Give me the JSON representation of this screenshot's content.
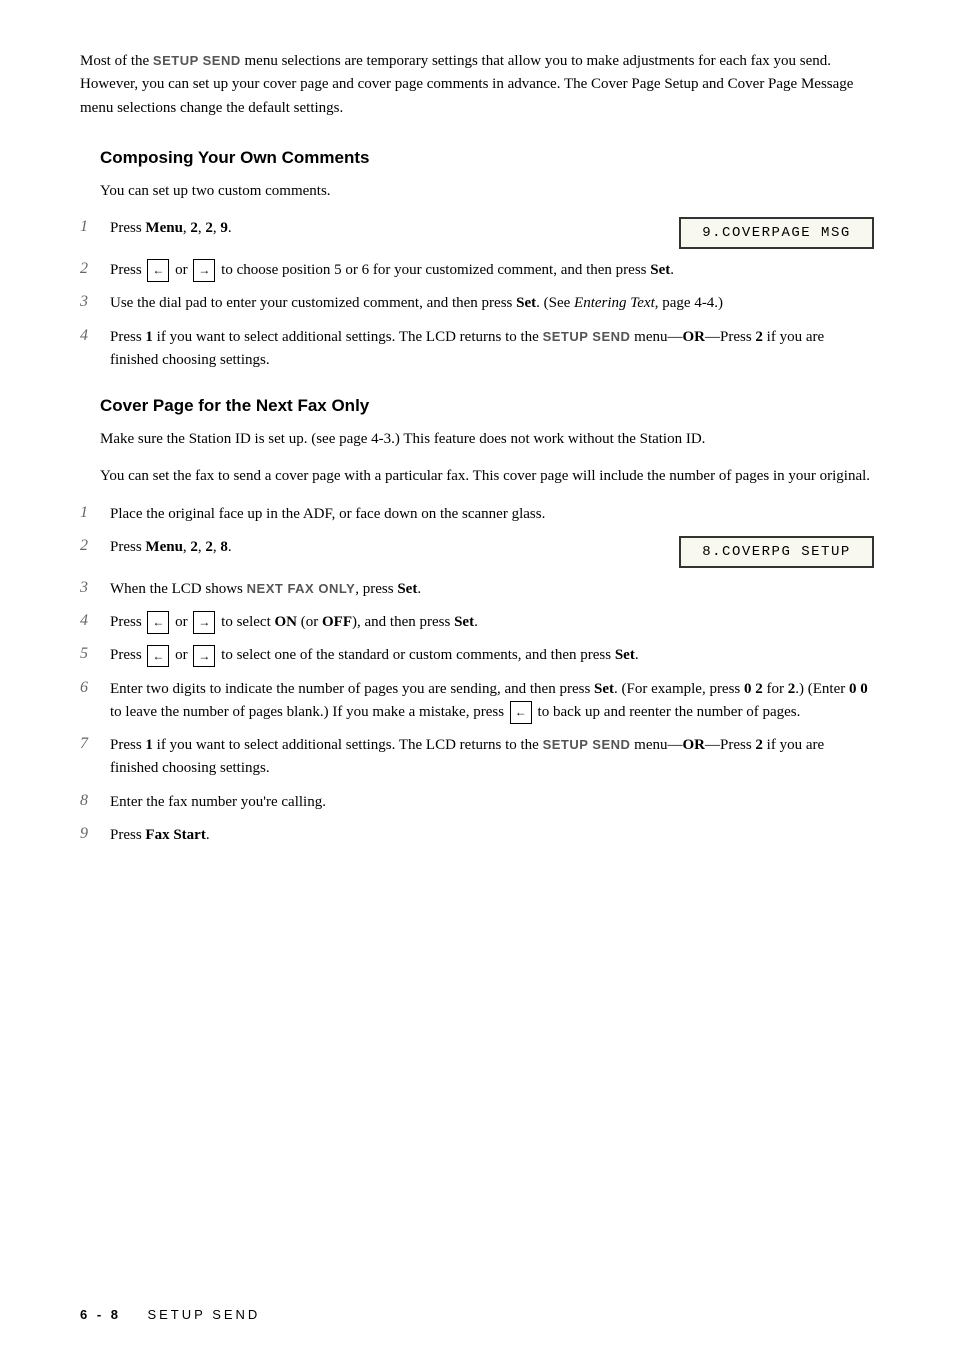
{
  "intro": {
    "text_parts": [
      "Most of the ",
      "SETUP SEND",
      " menu selections are temporary settings that allow you to make adjustments for each fax you send. However, you can set up your cover page and cover page comments in advance. The Cover Page Setup and Cover Page Message menu selections change the default settings."
    ]
  },
  "section1": {
    "heading": "Composing Your Own Comments",
    "intro": "You can set up two custom comments.",
    "steps": [
      {
        "num": "1",
        "text": "Press Menu, 2, 2, 9.",
        "lcd": "9.COVERPAGE MSG"
      },
      {
        "num": "2",
        "text": "Press ← or → to choose position 5 or 6 for your customized comment, and then press Set."
      },
      {
        "num": "3",
        "text": "Use the dial pad to enter your customized comment, and then press Set. (See Entering Text, page 4-4.)"
      },
      {
        "num": "4",
        "text": "Press 1 if you want to select additional settings. The LCD returns to the SETUP SEND menu—OR—Press 2 if you are finished choosing settings."
      }
    ]
  },
  "section2": {
    "heading": "Cover Page for the Next Fax Only",
    "intro1": "Make sure the Station ID is set up. (see page 4-3.) This feature does not work without the Station ID.",
    "intro2": "You can set the fax to send a cover page with a particular fax. This cover page will include the number of pages in your original.",
    "steps": [
      {
        "num": "1",
        "text": "Place the original face up in the ADF, or face down on the scanner glass."
      },
      {
        "num": "2",
        "text": "Press Menu, 2, 2, 8.",
        "lcd": "8.COVERPG SETUP"
      },
      {
        "num": "3",
        "text": "When the LCD shows NEXT FAX ONLY, press Set."
      },
      {
        "num": "4",
        "text": "Press ← or → to select ON (or OFF), and then press Set."
      },
      {
        "num": "5",
        "text": "Press ← or → to select one of the standard or custom comments, and then press Set."
      },
      {
        "num": "6",
        "text": "Enter two digits to indicate the number of pages you are sending, and then press Set. (For example, press 0 2 for 2.) (Enter 0 0 to leave the number of pages blank.) If you make a mistake, press ← to back up and reenter the number of pages."
      },
      {
        "num": "7",
        "text": "Press 1 if you want to select additional settings. The LCD returns to the SETUP SEND menu—OR—Press 2 if you are finished choosing settings."
      },
      {
        "num": "8",
        "text": "Enter the fax number you're calling."
      },
      {
        "num": "9",
        "text": "Press Fax Start."
      }
    ]
  },
  "footer": {
    "page": "6 - 8",
    "label": "SETUP SEND"
  }
}
